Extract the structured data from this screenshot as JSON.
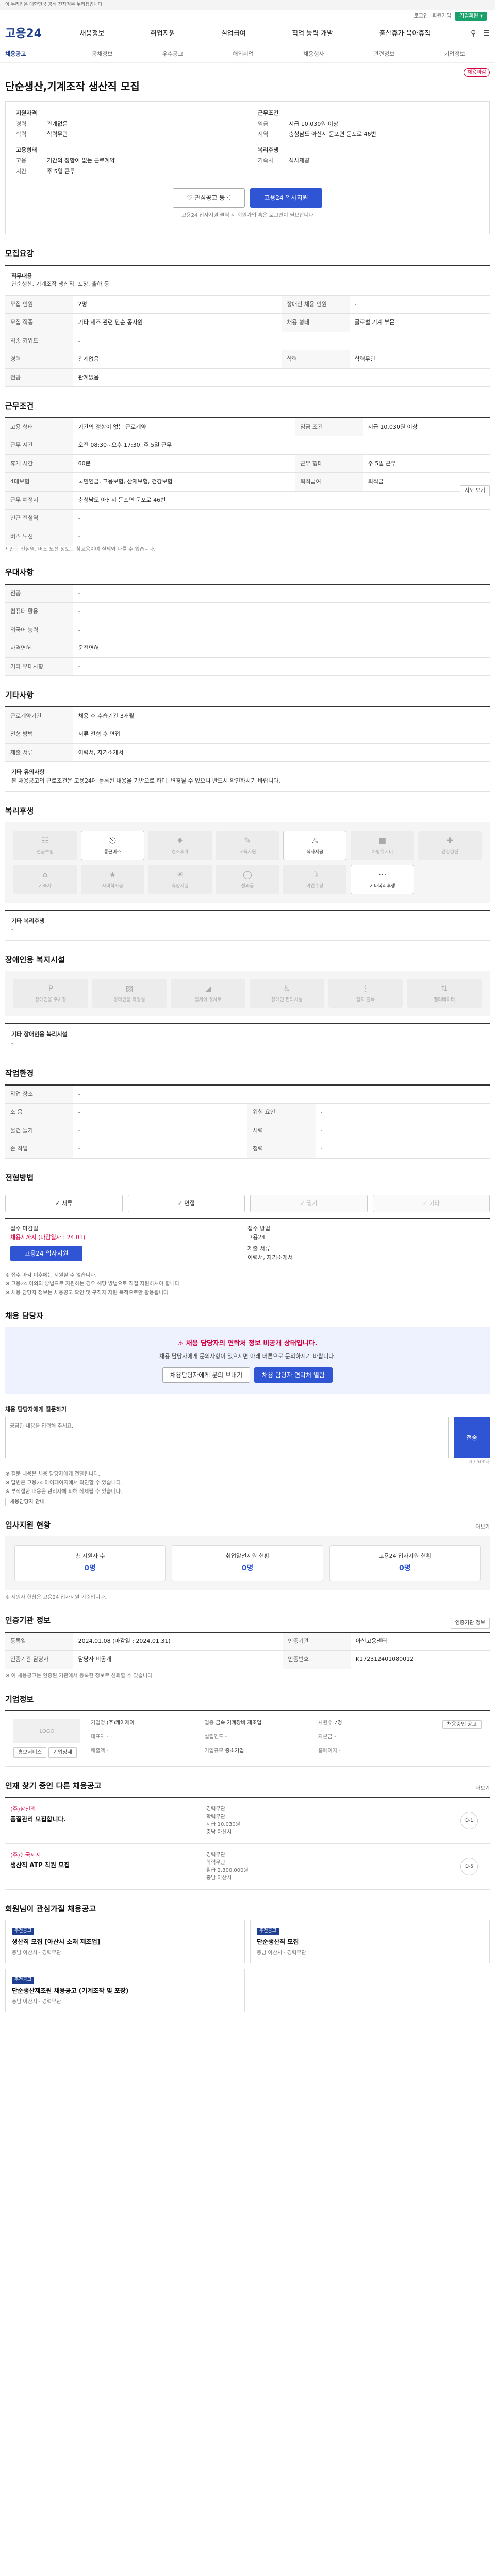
{
  "gov_banner": "이 누리집은 대한민국 공식 전자정부 누리집입니다.",
  "topbar": {
    "links": [
      "로그인",
      "회원가입"
    ],
    "cta": "기업회원 ▾"
  },
  "gnb": {
    "logo": "고용24",
    "menu": [
      "채용정보",
      "취업지원",
      "실업급여",
      "직업 능력 개발",
      "출산휴가·육아휴직"
    ],
    "icons": [
      "search-icon",
      "menu-icon"
    ]
  },
  "subnav": {
    "active": "채용공고",
    "items": [
      "공채정보",
      "우수공고",
      "해외취업",
      "채용행사",
      "관련정보",
      "기업정보"
    ]
  },
  "job": {
    "badge": "채용마감",
    "org": "관련없음",
    "title": "단순생산,기계조작 생산직 모집",
    "left_label": "지원자격",
    "left": [
      {
        "k": "경력",
        "v": "관계없음"
      },
      {
        "k": "학력",
        "v": "학력무관"
      }
    ],
    "right_label": "근무조건",
    "right": [
      {
        "k": "임금",
        "v": "시급 10,030원 이상"
      },
      {
        "k": "지역",
        "v": "충청남도 아산시 둔포면 둔포로 46번"
      }
    ],
    "left2_label": "고용형태",
    "left2": [
      {
        "k": "고용",
        "v": "기간의 정함이 없는 근로계약"
      },
      {
        "k": "시간",
        "v": "주 5일 근무"
      }
    ],
    "right2_label": "복리후생",
    "right2": [
      {
        "k": "기숙사",
        "v": "식사제공"
      }
    ],
    "bookmark": "관심공고 등록",
    "apply": "고용24 입사지원",
    "note": "고용24 입사지원 클릭 시 회원가입 혹은 로그인이 필요합니다"
  },
  "recruit": {
    "title": "모집요강",
    "duty_label": "직무내용",
    "duty": "단순생산, 기계조작 생산직, 포장, 출하 등",
    "rows": [
      [
        "모집 인원",
        "2명",
        "장애인 채용 인원",
        "-"
      ],
      [
        "모집 직종",
        "기타 제조 관련 단순 종사원",
        "채용 형태",
        "글로벌 기계 부문"
      ],
      [
        "직종 키워드",
        "-",
        "",
        ""
      ],
      [
        "경력",
        "관계없음",
        "학력",
        "학력무관"
      ],
      [
        "전공",
        "관계없음",
        "",
        ""
      ]
    ]
  },
  "conditions": {
    "title": "근무조건",
    "rows": [
      [
        "고용 형태",
        "기간의 정함이 없는 근로계약",
        "임금 조건",
        "시급 10,030원 이상"
      ],
      [
        "근무 시간",
        "오전 08:30~오후 17:30, 주 5일 근무",
        "",
        ""
      ],
      [
        "휴게 시간",
        "60분",
        "근무 형태",
        "주 5일 근무"
      ],
      [
        "4대보험",
        "국민연금, 고용보험, 산재보험, 건강보험",
        "퇴직급여",
        "퇴직금"
      ],
      [
        "근무 예정지",
        "충청남도 아산시 둔포면 둔포로 46번",
        "",
        ""
      ],
      [
        "인근 전철역",
        "-",
        "",
        ""
      ],
      [
        "버스 노선",
        "-",
        "",
        ""
      ]
    ],
    "map_btn": "지도 보기",
    "foot": "* 인근 전철역, 버스 노선 정보는 참고용이며 실제와 다를 수 있습니다."
  },
  "preference": {
    "title": "우대사항",
    "rows": [
      [
        "전공",
        "-"
      ],
      [
        "컴퓨터 활용",
        "-"
      ],
      [
        "외국어 능력",
        "-"
      ],
      [
        "자격면허",
        "운전면허"
      ],
      [
        "기타 우대사항",
        "-"
      ]
    ]
  },
  "etc": {
    "title": "기타사항",
    "rows": [
      [
        "근로계약기간",
        "채용 후 수습기간 3개월"
      ],
      [
        "전형 방법",
        "서류 전형 후 면접"
      ],
      [
        "제출 서류",
        "이력서, 자기소개서"
      ]
    ],
    "box_label": "기타 유의사항",
    "box": "본 채용공고의 근로조건은 고용24에 등록된 내용을 기반으로 하며, 변경될 수 있으니 반드시 확인하시기 바랍니다."
  },
  "welfare": {
    "title": "복리후생",
    "items": [
      {
        "label": "연금보험",
        "icon": "pension-icon",
        "on": false
      },
      {
        "label": "통근버스",
        "icon": "bus-icon",
        "on": true
      },
      {
        "label": "경조휴가",
        "icon": "gift-icon",
        "on": false
      },
      {
        "label": "교육지원",
        "icon": "book-icon",
        "on": false
      },
      {
        "label": "식사제공",
        "icon": "meal-icon",
        "on": true
      },
      {
        "label": "차량유지비",
        "icon": "car-icon",
        "on": false
      },
      {
        "label": "건강검진",
        "icon": "health-icon",
        "on": false
      },
      {
        "label": "기숙사",
        "icon": "house-icon",
        "on": false
      },
      {
        "label": "자녀학자금",
        "icon": "school-icon",
        "on": false
      },
      {
        "label": "휴양시설",
        "icon": "resort-icon",
        "on": false
      },
      {
        "label": "성과급",
        "icon": "money-icon",
        "on": false
      },
      {
        "label": "야간수당",
        "icon": "moon-icon",
        "on": false
      },
      {
        "label": "기타복리후생",
        "icon": "etc-icon",
        "on": true
      }
    ],
    "other_label": "기타 복리후생",
    "other": "-"
  },
  "disability": {
    "title": "장애인용 복지시설",
    "items": [
      "장애인용 주차장",
      "장애인용 화장실",
      "휠체어 경사로",
      "장애인 편의시설",
      "점자 블록",
      "엘리베이터"
    ],
    "other_label": "기타 장애인용 복리시설",
    "other": "-"
  },
  "workplace": {
    "title": "작업환경",
    "rows": [
      [
        "작업 장소",
        "-",
        "",
        ""
      ],
      [
        "소 음",
        "-",
        "위험 요인",
        "-"
      ],
      [
        "물건 들기",
        "-",
        "시력",
        "-"
      ],
      [
        "손 작업",
        "-",
        "청력",
        "-"
      ]
    ]
  },
  "apply": {
    "title": "전형방법",
    "methods": [
      {
        "label": "서류",
        "on": true
      },
      {
        "label": "면접",
        "on": true
      },
      {
        "label": "필기",
        "on": false
      },
      {
        "label": "기타",
        "on": false
      }
    ],
    "left_label": "접수 마감일",
    "left_value": "채용시까지 (마감일자 : 24.01)",
    "left_btn": "고용24 입사지원",
    "right_label": "접수 방법",
    "right_value": "고용24",
    "right_label2": "제출 서류",
    "right_value2": "이력서, 자기소개서",
    "notes": [
      "※ 접수 마감 이후에는 지원할 수 없습니다.",
      "※ 고용24 이외의 방법으로 지원하는 경우 해당 방법으로 직접 지원하셔야 합니다.",
      "※ 채용 담당자 정보는 채용공고 확인 및 구직자 지원 목적으로만 활용됩니다."
    ]
  },
  "manager": {
    "title": "채용 담당자",
    "box_title": "채용 담당자의 연락처 정보 비공개 상태입니다.",
    "box_text": "채용 담당자에게 문의사항이 있으시면 아래 버튼으로 문의하시기 바랍니다.",
    "btn1": "채용담당자에게 문의 보내기",
    "btn2": "채용 담당자 연락처 열람",
    "inquiry_label": "채용 담당자에게 질문하기",
    "inquiry_placeholder": "궁금한 내용을 입력해 주세요.",
    "send": "전송",
    "counter": "0 / 500자",
    "bullets": [
      "※ 질문 내용은 채용 담당자에게 전달됩니다.",
      "※ 답변은 고용24 마이페이지에서 확인할 수 있습니다.",
      "※ 부적절한 내용은 관리자에 의해 삭제될 수 있습니다."
    ],
    "guide_btn": "채용담당자 안내"
  },
  "status": {
    "title": "입사지원 현황",
    "more": "더보기",
    "items": [
      {
        "label": "총 지원자 수",
        "value": "0명"
      },
      {
        "label": "취업알선지원 현황",
        "value": "0명"
      },
      {
        "label": "고용24 입사지원 현황",
        "value": "0명"
      }
    ],
    "note": "※ 지원자 현황은 고용24 입사지원 기준입니다."
  },
  "info": {
    "title": "인증기관 정보",
    "btn": "인증기관 정보",
    "rows": [
      [
        "등록일",
        "2024.01.08 (마감일 : 2024.01.31)",
        "인증기관",
        "아산고용센터"
      ],
      [
        "인증기관 담당자",
        "담당자 비공개",
        "인증번호",
        "K172312401080012"
      ]
    ],
    "foot": "※ 이 채용공고는 인증된 기관에서 등록한 정보로 신뢰할 수 있습니다."
  },
  "company": {
    "title": "기업정보",
    "logo": "LOGO",
    "tags": [
      "홍보서비스",
      "기업상세"
    ],
    "info_btn": "채용중인 공고",
    "cells": [
      [
        "기업명",
        "(주)케이제이"
      ],
      [
        "업종",
        "금속 기계장비 제조업"
      ],
      [
        "사원수",
        "7명"
      ],
      [
        "대표자",
        "-"
      ],
      [
        "설립연도",
        "-"
      ],
      [
        "자본금",
        "-"
      ],
      [
        "매출액",
        "-"
      ],
      [
        "기업규모",
        "중소기업"
      ],
      [
        "홈페이지",
        "-"
      ]
    ],
    "badge_more": "더보기"
  },
  "similar": {
    "title": "인재 찾기 중인 다른 채용공고",
    "more": "더보기",
    "items": [
      {
        "org": "(주)삼천리",
        "title": "품질관리 모집합니다.",
        "meta": [
          "경력무관",
          "학력무관",
          "시급 10,030원",
          "충남 아산시"
        ],
        "dday": "D-1"
      },
      {
        "org": "(주)한국제지",
        "title": "생산직 ATP 직원 모집",
        "meta": [
          "경력무관",
          "학력무관",
          "월급 2,300,000원",
          "충남 아산시"
        ],
        "dday": "D-5"
      }
    ]
  },
  "recommend": {
    "title": "회원님이 관심가질 채용공고",
    "items": [
      {
        "tag": "추천공고",
        "title": "생산직 모집 [아산시 소재 제조업]",
        "meta": "충남 아산시 · 경력무관"
      },
      {
        "tag": "추천공고",
        "title": "단순생산직 모집",
        "meta": "충남 아산시 · 경력무관"
      },
      {
        "tag": "추천공고",
        "title": "단순생산제조원 채용공고 (기계조작 및 포장)",
        "meta": "충남 아산시 · 경력무관"
      }
    ]
  }
}
